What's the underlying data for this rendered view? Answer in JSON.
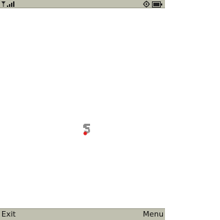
{
  "status_bar": {
    "signal_icon": "signal-strength-icon",
    "sync_icon": "sync-icon",
    "battery_icon": "battery-icon"
  },
  "content": {
    "loader_icon": "loading-spinner-icon"
  },
  "softkeys": {
    "left_label": "Exit",
    "right_label": "Menu"
  },
  "colors": {
    "bar_background": "#c0c0b0",
    "loader_gray": "#8c8c8c",
    "loader_red": "#e02020"
  }
}
